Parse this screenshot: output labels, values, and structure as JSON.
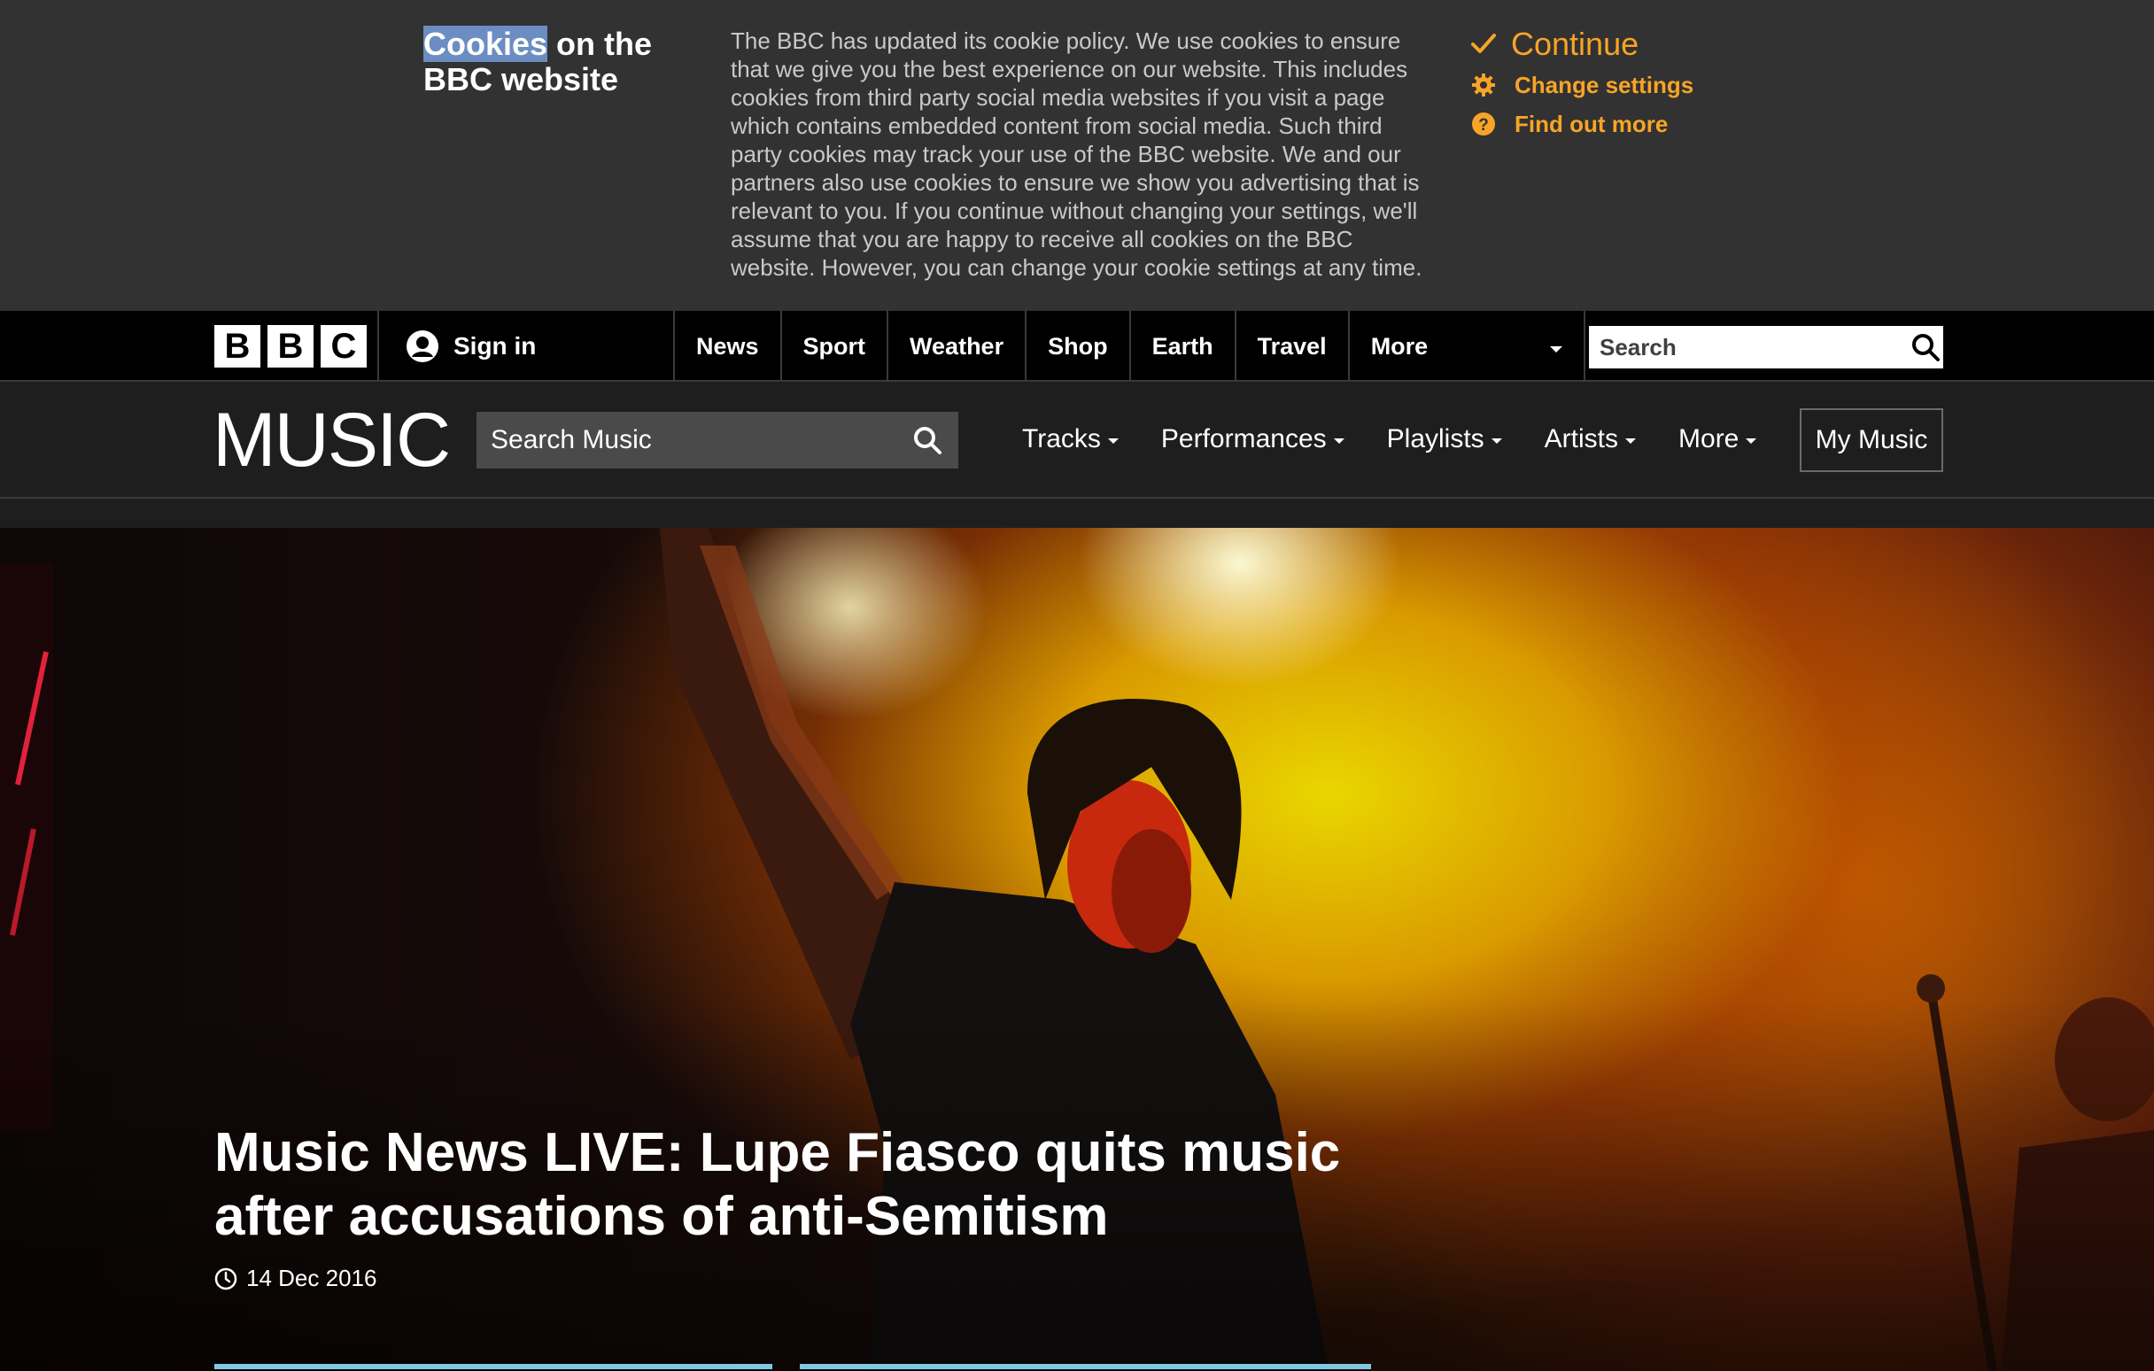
{
  "cookie_banner": {
    "title_highlight": "Cookies",
    "title_rest": " on the BBC website",
    "text": "The BBC has updated its cookie policy. We use cookies to ensure that we give you the best experience on our website. This includes cookies from third party social media websites if you visit a page which contains embedded content from social media. Such third party cookies may track your use of the BBC website. We and our partners also use cookies to ensure we show you advertising that is relevant to you. If you continue without changing your settings, we'll assume that you are happy to receive all cookies on the BBC website. However, you can change your cookie settings at any time.",
    "continue_label": "Continue",
    "change_settings_label": "Change settings",
    "find_out_more_label": "Find out more",
    "accent_color": "#f8a427"
  },
  "global_nav": {
    "logo_letters": [
      "B",
      "B",
      "C"
    ],
    "sign_in_label": "Sign in",
    "links": [
      "News",
      "Sport",
      "Weather",
      "Shop",
      "Earth",
      "Travel"
    ],
    "more_label": "More",
    "search_placeholder": "Search"
  },
  "music_header": {
    "logo": "MUSIC",
    "search_placeholder": "Search Music",
    "nav": [
      "Tracks",
      "Performances",
      "Playlists",
      "Artists",
      "More"
    ],
    "my_music_label": "My Music"
  },
  "hero": {
    "title": "Music News LIVE: Lupe Fiasco quits music after accusations of anti-Semitism",
    "date": "14 Dec 2016",
    "tab_color": "#7ec8e3"
  }
}
